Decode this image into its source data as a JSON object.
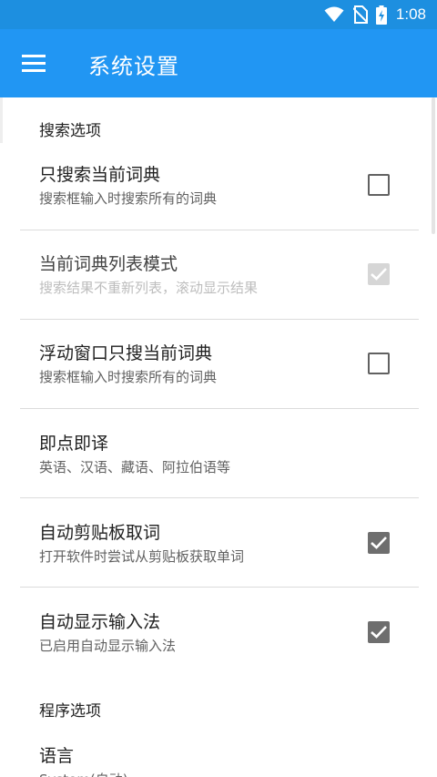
{
  "status_bar": {
    "time": "1:08",
    "icons": [
      "wifi-icon",
      "no-sim-icon",
      "battery-charging-icon"
    ]
  },
  "toolbar": {
    "menu_icon": "hamburger-menu-icon",
    "title": "系统设置"
  },
  "sections": {
    "search": {
      "header": "搜索选项"
    },
    "program": {
      "header": "程序选项"
    }
  },
  "prefs": {
    "search_current_dict": {
      "title": "只搜索当前词典",
      "summary": "搜索框输入时搜索所有的词典",
      "checked": false,
      "enabled": true
    },
    "dict_list_mode": {
      "title": "当前词典列表模式",
      "summary": "搜索结果不重新列表，滚动显示结果",
      "checked": true,
      "enabled": false
    },
    "float_window": {
      "title": "浮动窗口只搜当前词典",
      "summary": "搜索框输入时搜索所有的词典",
      "checked": false,
      "enabled": true
    },
    "instant_translate": {
      "title": "即点即译",
      "summary": "英语、汉语、藏语、阿拉伯语等"
    },
    "auto_clipboard": {
      "title": "自动剪贴板取词",
      "summary": "打开软件时尝试从剪贴板获取单词",
      "checked": true,
      "enabled": true
    },
    "auto_ime": {
      "title": "自动显示输入法",
      "summary": "已启用自动显示输入法",
      "checked": true,
      "enabled": true
    },
    "language": {
      "title": "语言",
      "summary": "System(自动)"
    }
  },
  "colors": {
    "toolbar": "#2196f3",
    "status_bar": "#1d8fe0",
    "checkbox_checked": "#6e6e6e",
    "checkbox_disabled": "#d6d6d6"
  }
}
